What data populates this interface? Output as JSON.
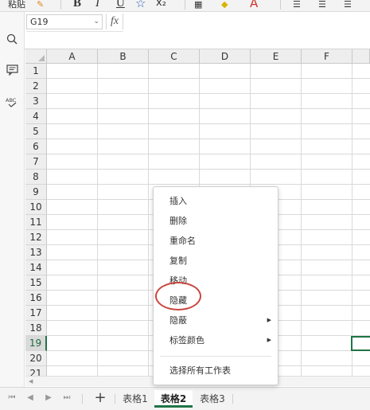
{
  "toolbar": {
    "paste_label": "粘贴",
    "bold": "B",
    "italic": "I",
    "underline": "U",
    "font_color_letter": "A"
  },
  "namebox": {
    "value": "G19"
  },
  "formula_bar": {
    "fx_label": "fx",
    "value": ""
  },
  "columns": [
    "A",
    "B",
    "C",
    "D",
    "E",
    "F"
  ],
  "rows": [
    "1",
    "2",
    "3",
    "4",
    "5",
    "6",
    "7",
    "8",
    "9",
    "10",
    "11",
    "12",
    "13",
    "14",
    "15",
    "16",
    "17",
    "18",
    "19",
    "20",
    "21"
  ],
  "active_row": "19",
  "context_menu": {
    "items": [
      {
        "label": "插入",
        "submenu": false
      },
      {
        "label": "删除",
        "submenu": false
      },
      {
        "label": "重命名",
        "submenu": false
      },
      {
        "label": "复制",
        "submenu": false
      },
      {
        "label": "移动",
        "submenu": false
      },
      {
        "label": "隐藏",
        "submenu": false
      },
      {
        "label": "隐蔽",
        "submenu": true
      },
      {
        "label": "标签颜色",
        "submenu": true
      },
      {
        "label": "选择所有工作表",
        "submenu": false
      }
    ],
    "highlighted": "隐藏"
  },
  "sheet_tabs": [
    {
      "label": "表格1",
      "active": false
    },
    {
      "label": "表格2",
      "active": true
    },
    {
      "label": "表格3",
      "active": false
    }
  ],
  "add_sheet_label": "+",
  "colors": {
    "accent": "#217346",
    "annotation": "#c9463d"
  }
}
